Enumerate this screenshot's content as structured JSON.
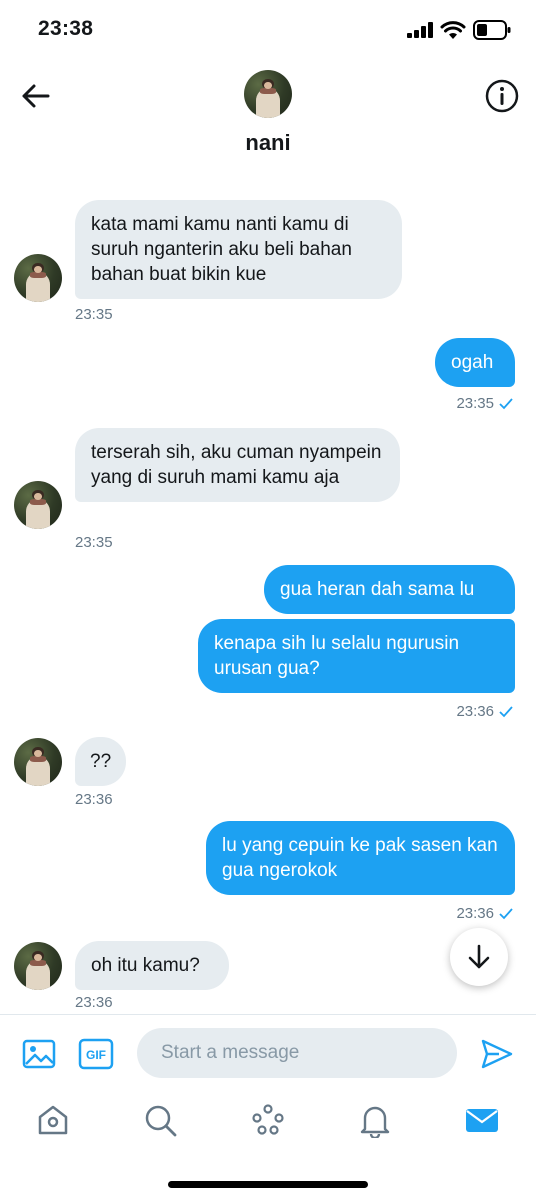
{
  "status_bar": {
    "time": "23:38"
  },
  "header": {
    "title": "nani"
  },
  "messages": [
    {
      "dir": "in",
      "text": "kata mami kamu nanti kamu di suruh nganterin aku beli bahan bahan buat bikin kue",
      "time": "23:35"
    },
    {
      "dir": "out",
      "text": "ogah",
      "time": "23:35"
    },
    {
      "dir": "in",
      "text": "terserah sih, aku cuman nyampein yang di suruh mami kamu aja",
      "time": "23:35"
    },
    {
      "dir": "out",
      "text": "gua heran dah sama lu",
      "time": ""
    },
    {
      "dir": "out",
      "text": "kenapa sih lu selalu ngurusin urusan gua?",
      "time": "23:36"
    },
    {
      "dir": "in",
      "text": "??",
      "time": "23:36"
    },
    {
      "dir": "out",
      "text": "lu yang cepuin ke pak sasen kan gua ngerokok",
      "time": "23:36"
    },
    {
      "dir": "in",
      "text": "oh itu kamu?",
      "time": "23:36"
    }
  ],
  "composer": {
    "placeholder": "Start a message"
  },
  "colors": {
    "accent": "#1da1f2",
    "incoming_bubble": "#e6ecf0",
    "timestamp": "#657786"
  },
  "icons": {
    "back": "arrow-left-icon",
    "info": "info-icon",
    "media": "image-icon",
    "gif": "gif-icon",
    "send": "send-icon",
    "scroll": "arrow-down-icon",
    "tabs": [
      "home-icon",
      "search-icon",
      "spaces-icon",
      "bell-icon",
      "mail-icon"
    ]
  }
}
